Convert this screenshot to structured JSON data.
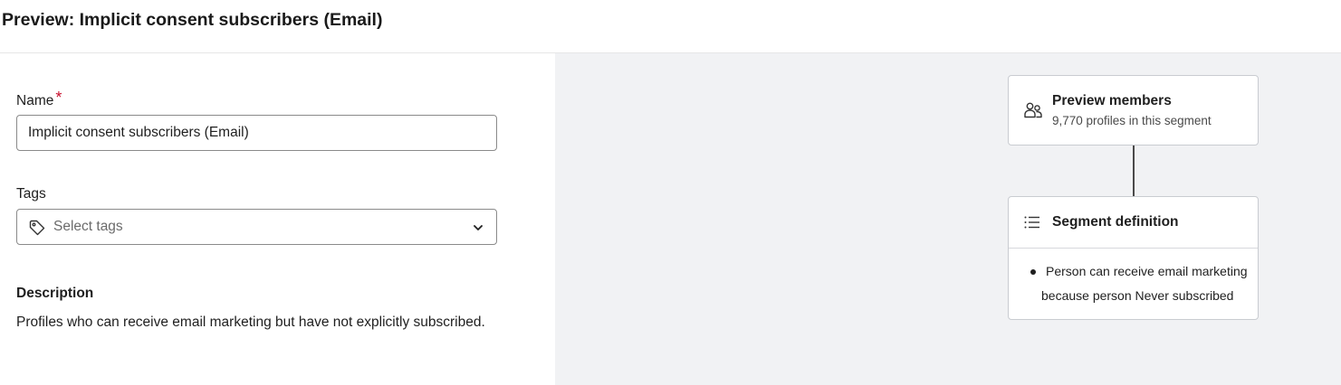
{
  "header": {
    "title": "Preview: Implicit consent subscribers (Email)"
  },
  "form": {
    "name_label": "Name",
    "required_marker": "*",
    "name_value": "Implicit consent subscribers (Email)",
    "tags_label": "Tags",
    "tags_placeholder": "Select tags",
    "description_heading": "Description",
    "description_text": "Profiles who can receive email marketing but have not explicitly subscribed."
  },
  "preview": {
    "members_title": "Preview members",
    "members_subtitle": "9,770 profiles in this segment",
    "definition_title": "Segment definition",
    "definition_line_1": "Person can receive email marketing",
    "definition_line_2": "because person Never subscribed"
  },
  "icons": {
    "tag": "tag-icon",
    "chevron": "chevron-down-icon",
    "members": "people-icon",
    "list": "list-icon"
  },
  "colors": {
    "required": "#c8102e",
    "right_pane_bg": "#f1f2f4",
    "border": "#8a8a8a",
    "card_border": "#c9ccd1"
  }
}
